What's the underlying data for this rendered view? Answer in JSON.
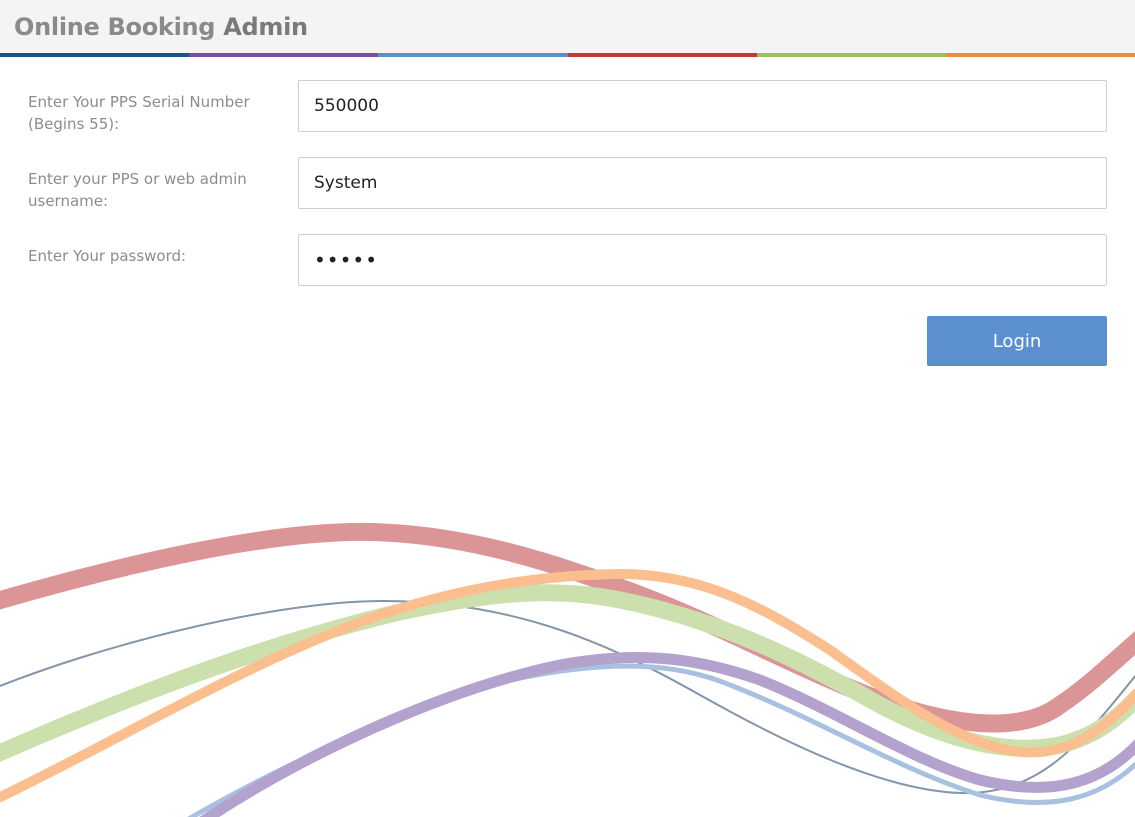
{
  "header": {
    "title_part1": "Online Booking ",
    "title_part2": "Admin",
    "bar_colors": [
      "#1f4e8c",
      "#7a4f9a",
      "#5b8fcf",
      "#c0393b",
      "#9dc25a",
      "#ee8d35"
    ]
  },
  "form": {
    "serial": {
      "label": "Enter Your PPS Serial Number (Begins 55):",
      "value": "550000"
    },
    "username": {
      "label": "Enter your PPS or web admin username:",
      "value": "System"
    },
    "password": {
      "label": "Enter Your password:",
      "value": "•••••"
    },
    "login_label": "Login"
  },
  "decoration": {
    "wave_colors": {
      "red": "#dc9597",
      "green": "#cce0ad",
      "orange": "#fbbe8f",
      "purple": "#b3a2cd",
      "blue": "#a8c1e1",
      "slate": "#8396a9"
    }
  }
}
